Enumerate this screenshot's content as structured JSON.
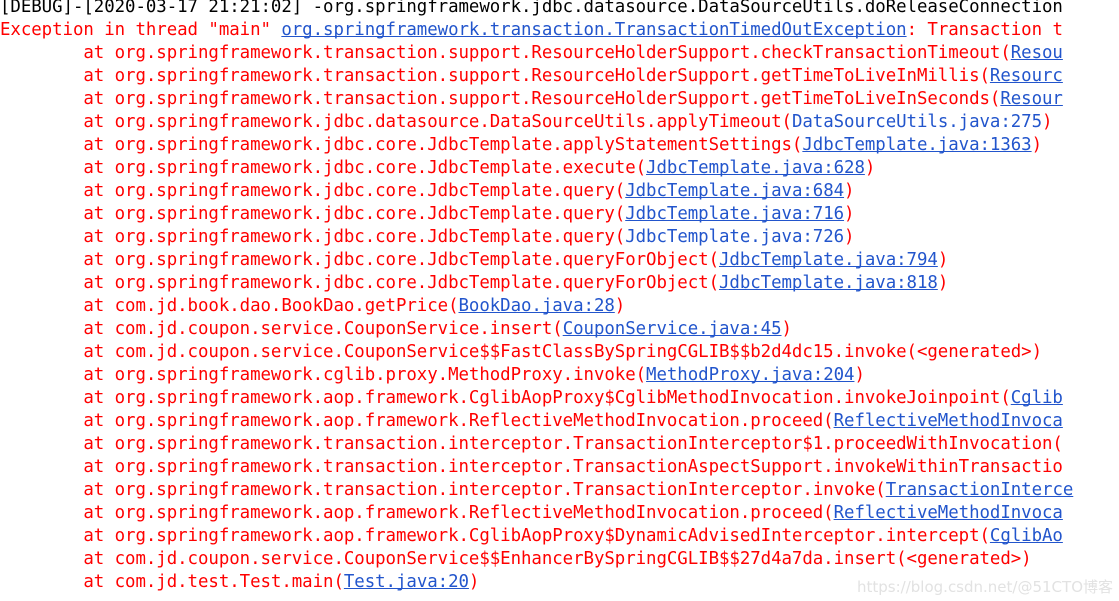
{
  "console": {
    "background_color": "#ffffff",
    "error_color": "#ff0000",
    "link_color": "#2255cc",
    "debug_color": "#000000",
    "watermark": "https://blog.csdn.net/@51CTO博客",
    "lines": [
      {
        "style": "debug",
        "segments": [
          {
            "text": "[DEBUG]-[2020-03-17 21:21:02] -org.springframework.jdbc.datasource.DataSourceUtils.doReleaseConnection",
            "kind": "plain"
          }
        ]
      },
      {
        "style": "err",
        "segments": [
          {
            "text": "Exception in thread \"main\" ",
            "kind": "plain"
          },
          {
            "text": "org.springframework.transaction.TransactionTimedOutException",
            "kind": "link"
          },
          {
            "text": ": Transaction t",
            "kind": "plain"
          }
        ]
      },
      {
        "style": "err",
        "segments": [
          {
            "text": "        at org.springframework.transaction.support.ResourceHolderSupport.checkTransactionTimeout(",
            "kind": "plain"
          },
          {
            "text": "Resou",
            "kind": "link"
          }
        ]
      },
      {
        "style": "err",
        "segments": [
          {
            "text": "        at org.springframework.transaction.support.ResourceHolderSupport.getTimeToLiveInMillis(",
            "kind": "plain"
          },
          {
            "text": "Resourc",
            "kind": "link"
          }
        ]
      },
      {
        "style": "err",
        "segments": [
          {
            "text": "        at org.springframework.transaction.support.ResourceHolderSupport.getTimeToLiveInSeconds(",
            "kind": "plain"
          },
          {
            "text": "Resour",
            "kind": "link"
          }
        ]
      },
      {
        "style": "err",
        "segments": [
          {
            "text": "        at org.springframework.jdbc.datasource.DataSourceUtils.applyTimeout(",
            "kind": "plain"
          },
          {
            "text": "DataSourceUtils.java:275",
            "kind": "linkplain"
          },
          {
            "text": ")",
            "kind": "plain"
          }
        ]
      },
      {
        "style": "err",
        "segments": [
          {
            "text": "        at org.springframework.jdbc.core.JdbcTemplate.applyStatementSettings(",
            "kind": "plain"
          },
          {
            "text": "JdbcTemplate.java:1363",
            "kind": "link"
          },
          {
            "text": ")",
            "kind": "plain"
          }
        ]
      },
      {
        "style": "err",
        "segments": [
          {
            "text": "        at org.springframework.jdbc.core.JdbcTemplate.execute(",
            "kind": "plain"
          },
          {
            "text": "JdbcTemplate.java:628",
            "kind": "link"
          },
          {
            "text": ")",
            "kind": "plain"
          }
        ]
      },
      {
        "style": "err",
        "segments": [
          {
            "text": "        at org.springframework.jdbc.core.JdbcTemplate.query(",
            "kind": "plain"
          },
          {
            "text": "JdbcTemplate.java:684",
            "kind": "link"
          },
          {
            "text": ")",
            "kind": "plain"
          }
        ]
      },
      {
        "style": "err",
        "segments": [
          {
            "text": "        at org.springframework.jdbc.core.JdbcTemplate.query(",
            "kind": "plain"
          },
          {
            "text": "JdbcTemplate.java:716",
            "kind": "link"
          },
          {
            "text": ")",
            "kind": "plain"
          }
        ]
      },
      {
        "style": "err",
        "segments": [
          {
            "text": "        at org.springframework.jdbc.core.JdbcTemplate.query(",
            "kind": "plain"
          },
          {
            "text": "JdbcTemplate.java:726",
            "kind": "linkplain"
          },
          {
            "text": ")",
            "kind": "plain"
          }
        ]
      },
      {
        "style": "err",
        "segments": [
          {
            "text": "        at org.springframework.jdbc.core.JdbcTemplate.queryForObject(",
            "kind": "plain"
          },
          {
            "text": "JdbcTemplate.java:794",
            "kind": "link"
          },
          {
            "text": ")",
            "kind": "plain"
          }
        ]
      },
      {
        "style": "err",
        "segments": [
          {
            "text": "        at org.springframework.jdbc.core.JdbcTemplate.queryForObject(",
            "kind": "plain"
          },
          {
            "text": "JdbcTemplate.java:818",
            "kind": "link"
          },
          {
            "text": ")",
            "kind": "plain"
          }
        ]
      },
      {
        "style": "err",
        "segments": [
          {
            "text": "        at com.jd.book.dao.BookDao.getPrice(",
            "kind": "plain"
          },
          {
            "text": "BookDao.java:28",
            "kind": "link"
          },
          {
            "text": ")",
            "kind": "plain"
          }
        ]
      },
      {
        "style": "err",
        "segments": [
          {
            "text": "        at com.jd.coupon.service.CouponService.insert(",
            "kind": "plain"
          },
          {
            "text": "CouponService.java:45",
            "kind": "link"
          },
          {
            "text": ")",
            "kind": "plain"
          }
        ]
      },
      {
        "style": "err",
        "segments": [
          {
            "text": "        at com.jd.coupon.service.CouponService$$FastClassBySpringCGLIB$$b2d4dc15.invoke(<generated>)",
            "kind": "plain"
          }
        ]
      },
      {
        "style": "err",
        "segments": [
          {
            "text": "        at org.springframework.cglib.proxy.MethodProxy.invoke(",
            "kind": "plain"
          },
          {
            "text": "MethodProxy.java:204",
            "kind": "link"
          },
          {
            "text": ")",
            "kind": "plain"
          }
        ]
      },
      {
        "style": "err",
        "segments": [
          {
            "text": "        at org.springframework.aop.framework.CglibAopProxy$CglibMethodInvocation.invokeJoinpoint(",
            "kind": "plain"
          },
          {
            "text": "Cglib",
            "kind": "link"
          }
        ]
      },
      {
        "style": "err",
        "segments": [
          {
            "text": "        at org.springframework.aop.framework.ReflectiveMethodInvocation.proceed(",
            "kind": "plain"
          },
          {
            "text": "ReflectiveMethodInvoca",
            "kind": "link"
          }
        ]
      },
      {
        "style": "err",
        "segments": [
          {
            "text": "        at org.springframework.transaction.interceptor.TransactionInterceptor$1.proceedWithInvocation(",
            "kind": "plain"
          }
        ]
      },
      {
        "style": "err",
        "segments": [
          {
            "text": "        at org.springframework.transaction.interceptor.TransactionAspectSupport.invokeWithinTransactio",
            "kind": "plain"
          }
        ]
      },
      {
        "style": "err",
        "segments": [
          {
            "text": "        at org.springframework.transaction.interceptor.TransactionInterceptor.invoke(",
            "kind": "plain"
          },
          {
            "text": "TransactionInterce",
            "kind": "link"
          }
        ]
      },
      {
        "style": "err",
        "segments": [
          {
            "text": "        at org.springframework.aop.framework.ReflectiveMethodInvocation.proceed(",
            "kind": "plain"
          },
          {
            "text": "ReflectiveMethodInvoca",
            "kind": "link"
          }
        ]
      },
      {
        "style": "err",
        "segments": [
          {
            "text": "        at org.springframework.aop.framework.CglibAopProxy$DynamicAdvisedInterceptor.intercept(",
            "kind": "plain"
          },
          {
            "text": "CglibAo",
            "kind": "link"
          }
        ]
      },
      {
        "style": "err",
        "segments": [
          {
            "text": "        at com.jd.coupon.service.CouponService$$EnhancerBySpringCGLIB$$27d4a7da.insert(<generated>)",
            "kind": "plain"
          }
        ]
      },
      {
        "style": "err",
        "segments": [
          {
            "text": "        at com.jd.test.Test.main(",
            "kind": "plain"
          },
          {
            "text": "Test.java:20",
            "kind": "link"
          },
          {
            "text": ")",
            "kind": "plain"
          }
        ]
      }
    ]
  }
}
